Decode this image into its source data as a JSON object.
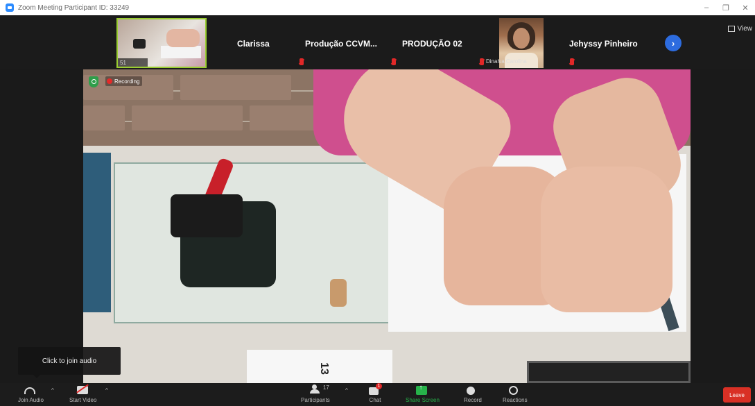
{
  "window": {
    "title": "Zoom Meeting Participant ID: 33249",
    "minimize": "–",
    "restore": "❐",
    "close": "✕"
  },
  "gallery": {
    "view_label": "View",
    "participants": [
      {
        "name": "Clarissa",
        "muted": false
      },
      {
        "name": "Produção  CCVM...",
        "muted": true
      },
      {
        "name": "PRODUÇÃO 02",
        "muted": true
      },
      {
        "name": "Dinalva Carolina",
        "muted": true,
        "has_photo": true
      },
      {
        "name": "Jehyssy Pinheiro",
        "muted": true
      }
    ],
    "self_label": "51",
    "next_page": "›"
  },
  "meeting": {
    "recording_label": "Recording",
    "card_text": "13"
  },
  "toolbar": {
    "join_audio": "Join Audio",
    "start_video": "Start Video",
    "participants": "Participants",
    "participants_count": "17",
    "chat": "Chat",
    "chat_badge": "1",
    "share_screen": "Share Screen",
    "record": "Record",
    "reactions": "Reactions",
    "leave": "Leave"
  },
  "tooltip": {
    "text": "Click to join audio"
  },
  "colors": {
    "accent": "#2d8cff",
    "leave": "#d93025",
    "share": "#27b34a",
    "muted": "#e02828"
  }
}
